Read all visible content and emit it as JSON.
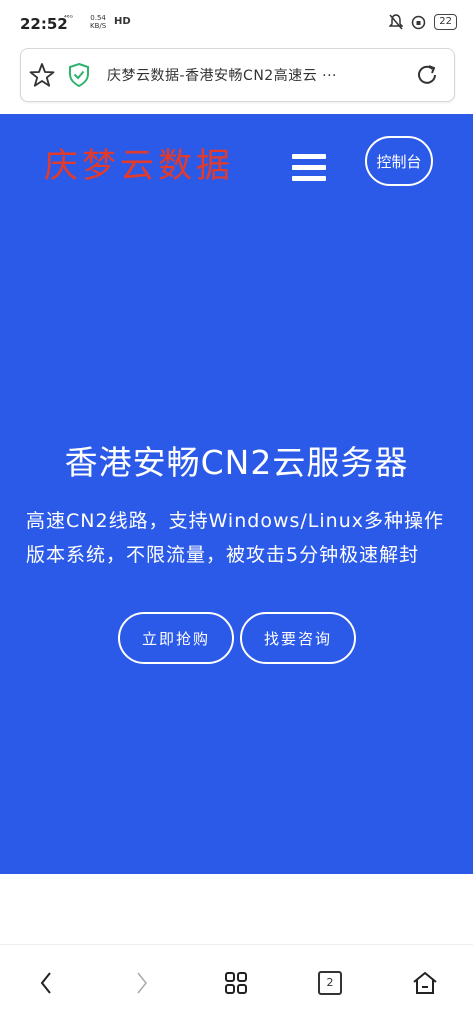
{
  "status_bar": {
    "time": "22:52",
    "network": "⁴⁶ᴳ",
    "speed": "0.54",
    "speed_unit": "KB/S",
    "hd": "HD",
    "battery": "22"
  },
  "browser": {
    "url_title": "庆梦云数据-香港安畅CN2高速云 ···"
  },
  "header": {
    "brand": "庆梦云数据",
    "console_label": "控制台"
  },
  "hero": {
    "title": "香港安畅CN2云服务器",
    "subtitle": "高速CN2线路，支持Windows/Linux多种操作版本系统，不限流量，被攻击5分钟极速解封",
    "buy_label": "立即抢购",
    "consult_label": "找要咨询"
  },
  "bottom_nav": {
    "tab_count": "2"
  },
  "colors": {
    "hero_bg": "#2c5ae8",
    "brand": "#e23b2b",
    "shield": "#2db36b"
  }
}
